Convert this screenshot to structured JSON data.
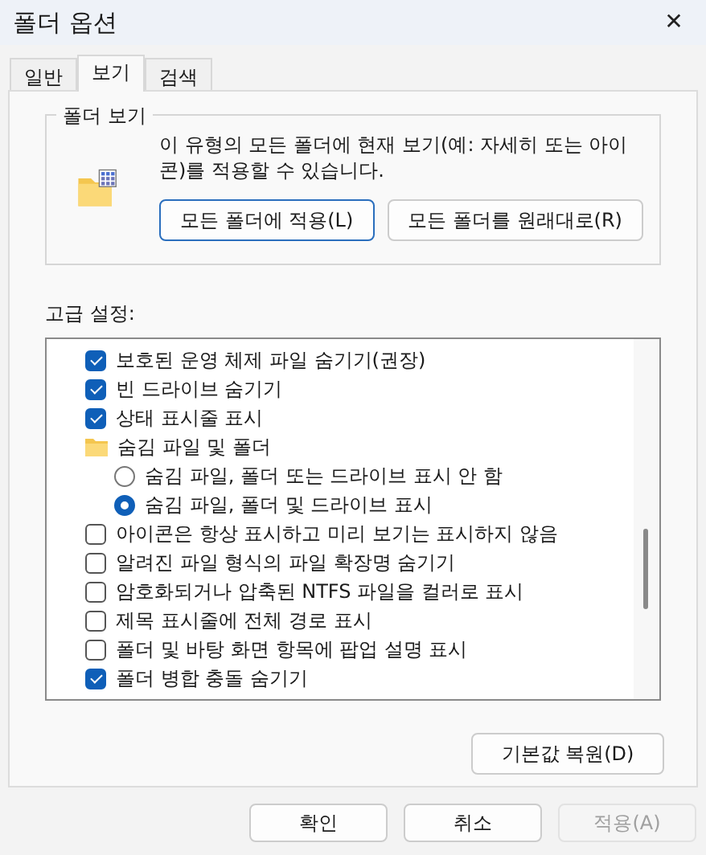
{
  "window": {
    "title": "폴더 옵션",
    "close": "✕"
  },
  "tabs": [
    {
      "label": "일반",
      "selected": false
    },
    {
      "label": "보기",
      "selected": true
    },
    {
      "label": "검색",
      "selected": false
    }
  ],
  "folder_views": {
    "title": "폴더 보기",
    "description": "이 유형의 모든 폴더에 현재 보기(예: 자세히 또는 아이콘)를 적용할 수 있습니다.",
    "buttons": [
      "모든 폴더에 적용(L)",
      "모든 폴더를 원래대로(R)"
    ]
  },
  "advanced": {
    "label": "고급 설정:",
    "items": [
      {
        "kind": "checkbox",
        "label": "보호된 운영 체제 파일 숨기기(권장)",
        "checked": true
      },
      {
        "kind": "checkbox",
        "label": "빈 드라이브 숨기기",
        "checked": true
      },
      {
        "kind": "checkbox",
        "label": "상태 표시줄 표시",
        "checked": true
      },
      {
        "kind": "folder",
        "label": "숨김 파일 및 폴더"
      },
      {
        "kind": "radio",
        "label": "숨김 파일, 폴더 또는 드라이브 표시 안 함",
        "selected": false
      },
      {
        "kind": "radio",
        "label": "숨김 파일, 폴더 및 드라이브 표시",
        "selected": true
      },
      {
        "kind": "checkbox",
        "label": "아이콘은 항상 표시하고 미리 보기는 표시하지 않음",
        "checked": false
      },
      {
        "kind": "checkbox",
        "label": "알려진 파일 형식의 파일 확장명 숨기기",
        "checked": false
      },
      {
        "kind": "checkbox",
        "label": "암호화되거나 압축된 NTFS 파일을 컬러로 표시",
        "checked": false
      },
      {
        "kind": "checkbox",
        "label": "제목 표시줄에 전체 경로 표시",
        "checked": false
      },
      {
        "kind": "checkbox",
        "label": "폴더 및 바탕 화면 항목에 팝업 설명 표시",
        "checked": false
      },
      {
        "kind": "checkbox",
        "label": "폴더 병합 충돌 숨기기",
        "checked": true
      }
    ],
    "restore_button": "기본값 복원(D)"
  },
  "footer": [
    {
      "label": "확인",
      "disabled": false
    },
    {
      "label": "취소",
      "disabled": false
    },
    {
      "label": "적용(A)",
      "disabled": true
    }
  ]
}
